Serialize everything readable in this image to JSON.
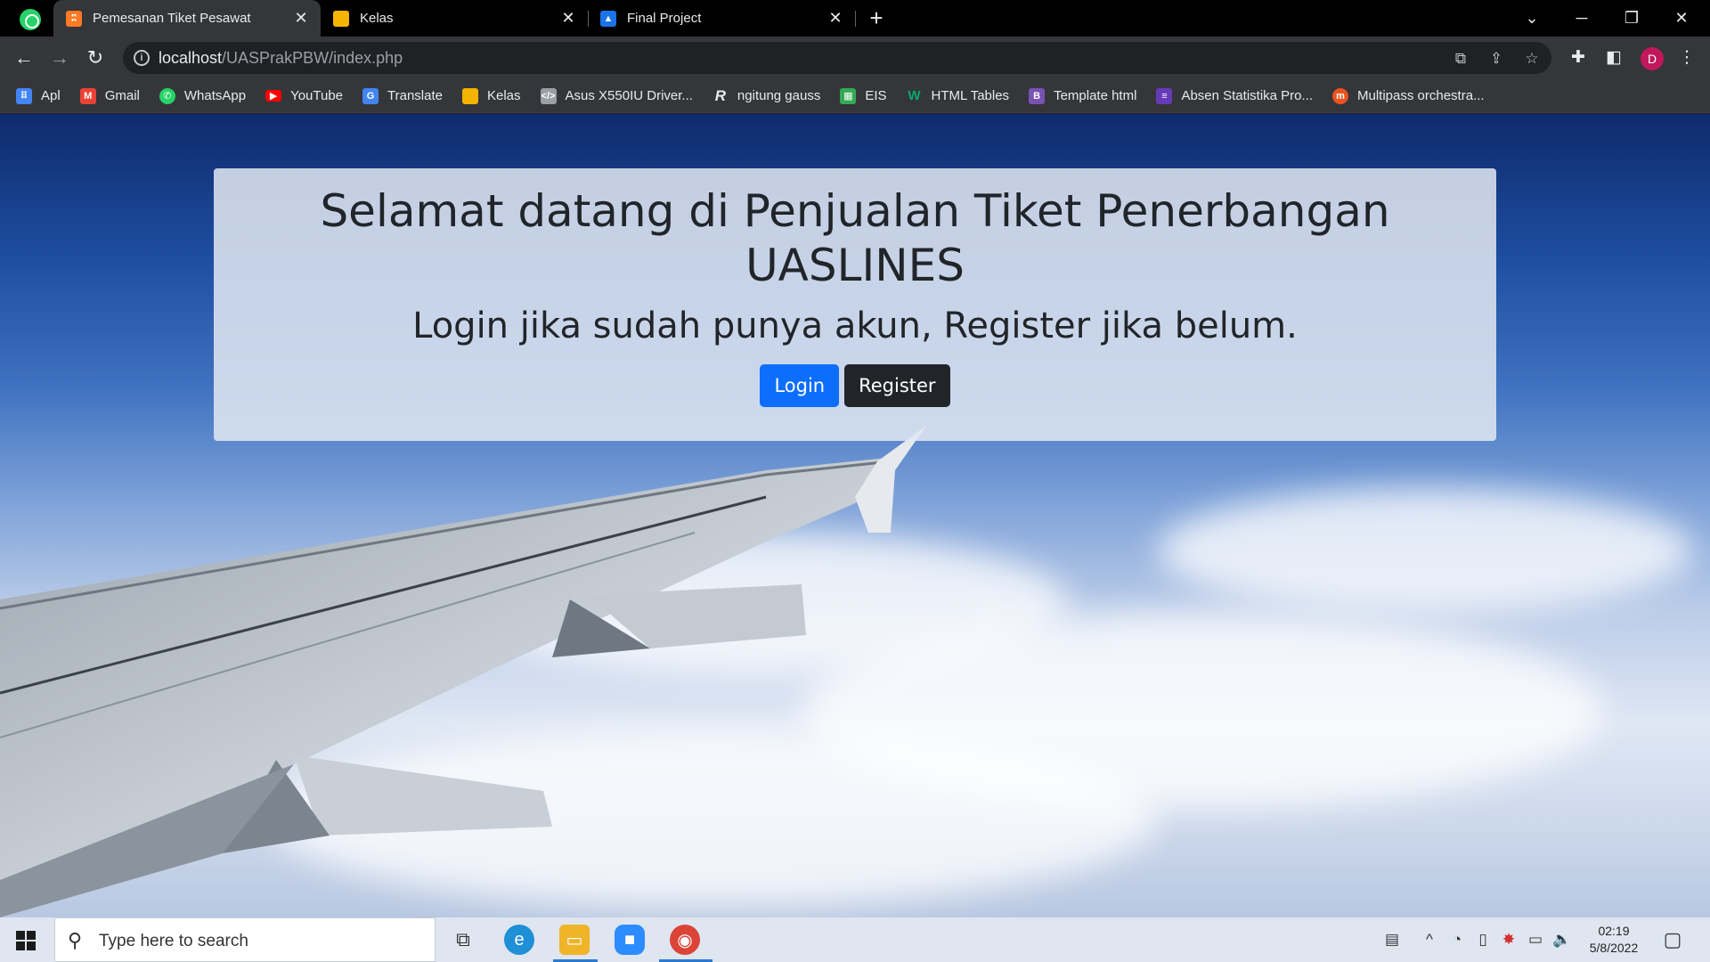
{
  "browser": {
    "tabs": [
      {
        "title": "Pemesanan Tiket Pesawat",
        "icon": "xampp-icon",
        "color": "#fb7a24",
        "active": true
      },
      {
        "title": "Kelas",
        "icon": "classroom-icon",
        "color": "#1e8e3e",
        "active": false
      },
      {
        "title": "Final Project",
        "icon": "classroom-assignment-icon",
        "color": "#1a73e8",
        "active": false
      }
    ],
    "url_host": "localhost",
    "url_path": "/UASPrakPBW/index.php",
    "profile_initial": "D",
    "bookmarks": [
      {
        "label": "Apl",
        "icon": "apps-grid-icon",
        "color": "#4285f4"
      },
      {
        "label": "Gmail",
        "icon": "gmail-icon",
        "color": "#ea4335"
      },
      {
        "label": "WhatsApp",
        "icon": "whatsapp-icon",
        "color": "#25d366"
      },
      {
        "label": "YouTube",
        "icon": "youtube-icon",
        "color": "#ff0000"
      },
      {
        "label": "Translate",
        "icon": "translate-icon",
        "color": "#4285f4"
      },
      {
        "label": "Kelas",
        "icon": "classroom-icon",
        "color": "#1e8e3e"
      },
      {
        "label": "Asus X550IU Driver...",
        "icon": "page-icon",
        "color": "#9aa0a6"
      },
      {
        "label": "ngitung gauss",
        "icon": "r-logo-icon",
        "color": "#5f6368"
      },
      {
        "label": "EIS",
        "icon": "eis-icon",
        "color": "#34a853"
      },
      {
        "label": "HTML Tables",
        "icon": "w3schools-icon",
        "color": "#04aa6d"
      },
      {
        "label": "Template html",
        "icon": "bootstrap-icon",
        "color": "#7952b3"
      },
      {
        "label": "Absen Statistika Pro...",
        "icon": "forms-icon",
        "color": "#673ab7"
      },
      {
        "label": "Multipass orchestra...",
        "icon": "multipass-icon",
        "color": "#e95420"
      }
    ]
  },
  "page": {
    "title": "Selamat datang di Penjualan Tiket Penerbangan UASLINES",
    "subtitle": "Login jika sudah punya akun, Register jika belum.",
    "login_label": "Login",
    "register_label": "Register"
  },
  "taskbar": {
    "search_placeholder": "Type here to search",
    "time": "02:19",
    "date": "5/8/2022"
  }
}
